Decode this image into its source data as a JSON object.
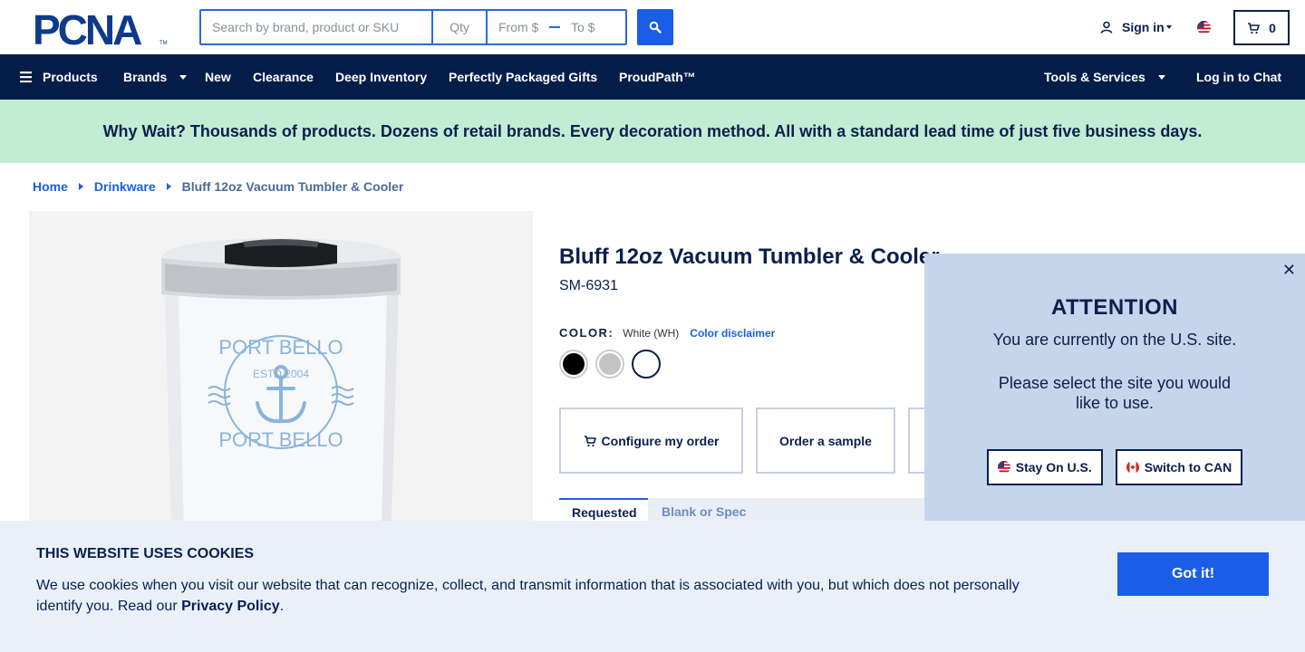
{
  "header": {
    "logo_text": "PCNA",
    "search": {
      "placeholder": "Search by brand, product or SKU",
      "value": ""
    },
    "qty": {
      "placeholder": "Qty"
    },
    "price_from": {
      "placeholder": "From $"
    },
    "price_to": {
      "placeholder": "To $"
    },
    "sign_in_label": "Sign in",
    "cart_count": "0"
  },
  "nav": {
    "items": [
      {
        "label": "Products"
      },
      {
        "label": "Brands"
      },
      {
        "label": "New"
      },
      {
        "label": "Clearance"
      },
      {
        "label": "Deep Inventory"
      },
      {
        "label": "Perfectly Packaged Gifts"
      },
      {
        "label": "ProudPath™"
      }
    ],
    "tools_label": "Tools & Services",
    "chat_label": "Log in to Chat"
  },
  "promo": {
    "text": "Why Wait? Thousands of products. Dozens of retail brands. Every decoration method. All with a standard lead time of just five business days."
  },
  "breadcrumb": {
    "items": [
      "Home",
      "Drinkware"
    ],
    "current": "Bluff 12oz Vacuum Tumbler & Cooler"
  },
  "product": {
    "title": "Bluff 12oz Vacuum Tumbler & Cooler",
    "sku": "SM-6931",
    "color_label": "COLOR:",
    "color_value": "White (WH)",
    "color_disclaimer": "Color disclaimer",
    "swatches": [
      {
        "name": "Black",
        "hex": "#000000"
      },
      {
        "name": "Silver",
        "hex": "#c4c4c4"
      },
      {
        "name": "White",
        "hex": "#ffffff",
        "selected": true
      }
    ],
    "image_text": {
      "top": "PORT BELLO",
      "est": "ESTD 2004",
      "bottom": "PORT BELLO"
    },
    "actions": {
      "configure": "Configure my order",
      "sample": "Order a sample"
    },
    "tabs": [
      "Requested",
      "Blank or Spec"
    ]
  },
  "region_popup": {
    "title": "ATTENTION",
    "line1": "You are currently on the U.S. site.",
    "line2": "Please select the site you would like to use.",
    "stay_label": "Stay On U.S.",
    "switch_label": "Switch to CAN"
  },
  "cookie": {
    "title": "THIS WEBSITE USES COOKIES",
    "text_before": "We use cookies when you visit our website that can recognize, collect, and transmit information that is associated with you, but which does not personally identify you. Read our ",
    "link": "Privacy Policy",
    "text_after": ".",
    "button": "Got it!"
  },
  "colors": {
    "navy": "#071d49",
    "accent_blue": "#1a5ee8",
    "promo_green": "#c3ecd5",
    "popup_bg": "#c5d5ec",
    "cookie_bg": "#e9f0fa"
  }
}
